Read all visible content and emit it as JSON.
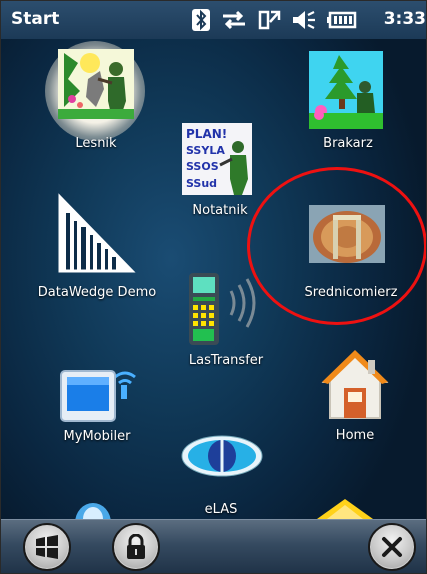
{
  "statusbar": {
    "title": "Start",
    "time": "3:33",
    "icons": [
      "bluetooth-icon",
      "data-transfer-icon",
      "signal-icon",
      "volume-icon",
      "battery-icon"
    ]
  },
  "tiles": {
    "lesnik": "Lesnik",
    "brakarz": "Brakarz",
    "notatnik": "Notatnik",
    "datawedge": "DataWedge Demo",
    "srednicomierz": "Srednicomierz",
    "lastransfer": "LasTransfer",
    "mymobiler": "MyMobiler",
    "home": "Home",
    "elas": "eLAS"
  },
  "notatnik_icon_text": [
    "PLAN!",
    "SSYLA",
    "SSOS",
    "SSud"
  ],
  "colors": {
    "highlight": "#ee1111",
    "text": "#ffffff"
  },
  "taskbar": {
    "buttons": [
      "windows-start-icon",
      "lock-icon",
      "close-icon"
    ]
  }
}
